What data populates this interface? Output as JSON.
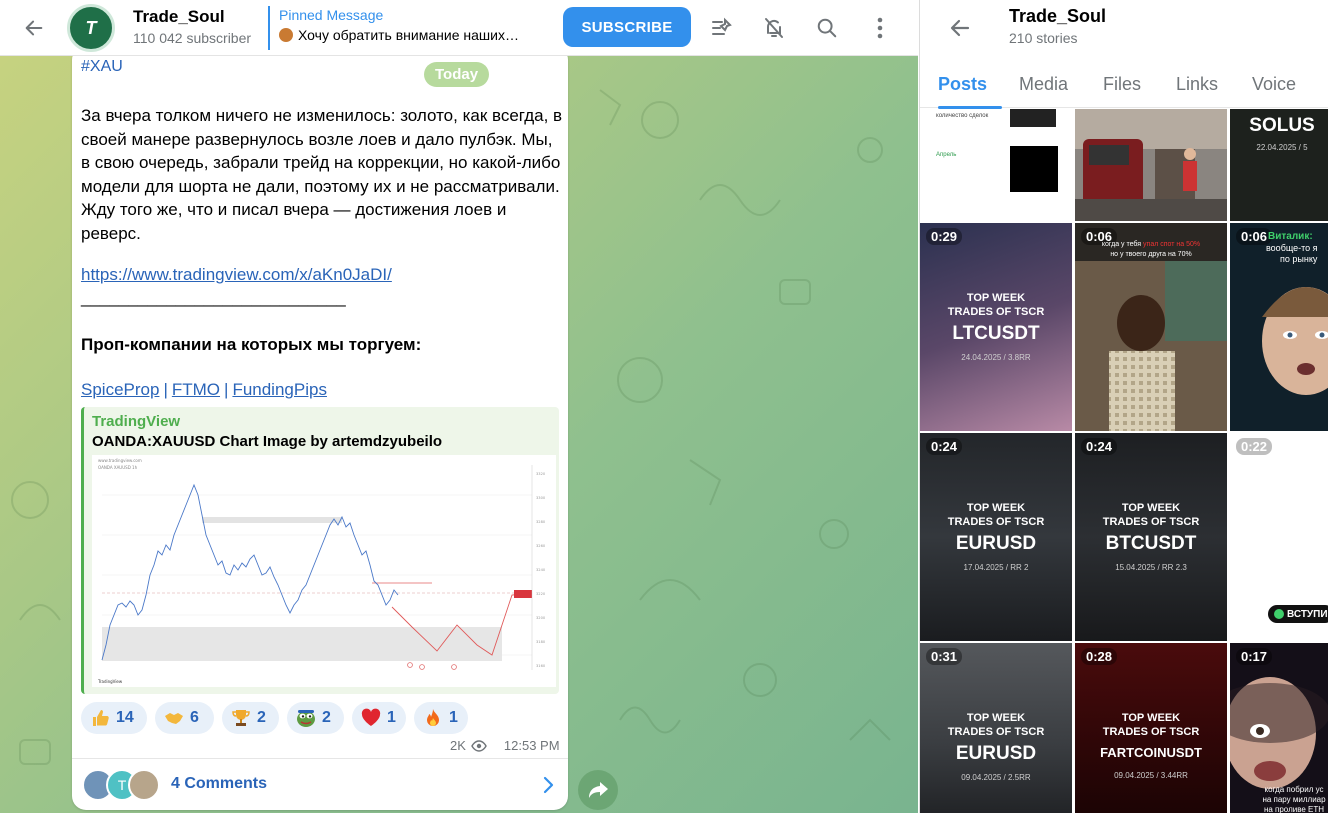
{
  "chat": {
    "title": "Trade_Soul",
    "subscribers": "110 042 subscriber",
    "avatar_text": "T",
    "pinned_label": "Pinned Message",
    "pinned_text": "Хочу обратить внимание наших…",
    "subscribe_label": "SUBSCRIBE"
  },
  "message": {
    "hashtag": "#XAU",
    "date_pill": "Today",
    "body": "За вчера толком ничего не изменилось: золото, как всегда, в своей манере развернулось возле лоев и дало пулбэк. Мы, в свою очередь, забрали трейд на коррекции, но какой-либо модели для шорта не дали, поэтому их и не рассматривали. Жду того же, что и писал вчера — достижения лоев и реверс.",
    "link": "https://www.tradingview.com/x/aKn0JaDI/",
    "separator": "____________________________",
    "props_heading": "Проп-компании на которых мы торгуем:",
    "props": [
      "SpiceProp",
      "FTMO",
      "FundingPips"
    ],
    "props_separator": "|",
    "preview_site": "TradingView",
    "preview_title": "OANDA:XAUUSD Chart Image by artemdzyubeilo",
    "reactions": [
      {
        "emoji": "thumbs-up",
        "count": "14"
      },
      {
        "emoji": "handshake",
        "count": "6"
      },
      {
        "emoji": "trophy",
        "count": "2"
      },
      {
        "emoji": "pepe",
        "count": "2"
      },
      {
        "emoji": "heart",
        "count": "1"
      },
      {
        "emoji": "fire",
        "count": "1"
      }
    ],
    "views": "2K",
    "time": "12:53 PM",
    "comments_label": "4 Comments",
    "comment_avatar_letter": "T"
  },
  "panel": {
    "title": "Trade_Soul",
    "subtitle": "210 stories",
    "tabs": [
      "Posts",
      "Media",
      "Files",
      "Links",
      "Voice"
    ],
    "active_tab": "Posts",
    "tiles": [
      {
        "duration": "",
        "line1": "",
        "line2": "",
        "line3": "",
        "style": "doc",
        "top_caption": "количество сделок",
        "mid_caption": "Апрель"
      },
      {
        "duration": "",
        "line1": "",
        "line2": "",
        "line3": "",
        "style": "street"
      },
      {
        "duration": "",
        "line1": "",
        "line2": "SOLUS",
        "line3": "22.04.2025 / 5",
        "style": "dark"
      },
      {
        "duration": "0:29",
        "line1": "TOP WEEK\nTRADES OF TSCR",
        "line2": "LTCUSDT",
        "line3": "24.04.2025 / 3.8RR",
        "style": "purple"
      },
      {
        "duration": "0:06",
        "line1": "",
        "line2": "",
        "line3": "",
        "style": "kid",
        "caption_top": "когда у тебя ",
        "caption_red": "упал спот на 50%",
        "caption_bottom": "но у твоего друга на 70%"
      },
      {
        "duration": "0:06",
        "line1": "",
        "line2": "",
        "line3": "",
        "style": "man",
        "caption_green": "Виталик:",
        "caption_white": "вообще-то я",
        "caption_white2": "по рынку"
      },
      {
        "duration": "0:24",
        "line1": "TOP WEEK\nTRADES OF TSCR",
        "line2": "EURUSD",
        "line3": "17.04.2025 / RR 2",
        "style": "dark"
      },
      {
        "duration": "0:24",
        "line1": "TOP WEEK\nTRADES OF TSCR",
        "line2": "BTCUSDT",
        "line3": "15.04.2025 / RR 2.3",
        "style": "dark"
      },
      {
        "duration": "0:22",
        "line1": "",
        "line2": "",
        "line3": "",
        "style": "white",
        "badge": "ВСТУПИ"
      },
      {
        "duration": "0:31",
        "line1": "TOP WEEK\nTRADES OF TSCR",
        "line2": "EURUSD",
        "line3": "09.04.2025 / 2.5RR",
        "style": "grey"
      },
      {
        "duration": "0:28",
        "line1": "TOP WEEK\nTRADES OF TSCR",
        "line2": "FARTCOINUSDT",
        "line3": "09.04.2025 / 3.44RR",
        "style": "red"
      },
      {
        "duration": "0:17",
        "line1": "",
        "line2": "",
        "line3": "",
        "style": "face",
        "caption_a": "когда побрил ус",
        "caption_b": "на пару миллиар",
        "caption_c": "на проливе ETH"
      }
    ]
  },
  "colors": {
    "accent": "#3390ec",
    "link": "#2a64b8",
    "preview_green": "#4fae4e",
    "reaction_bg": "#e8f0f9"
  }
}
